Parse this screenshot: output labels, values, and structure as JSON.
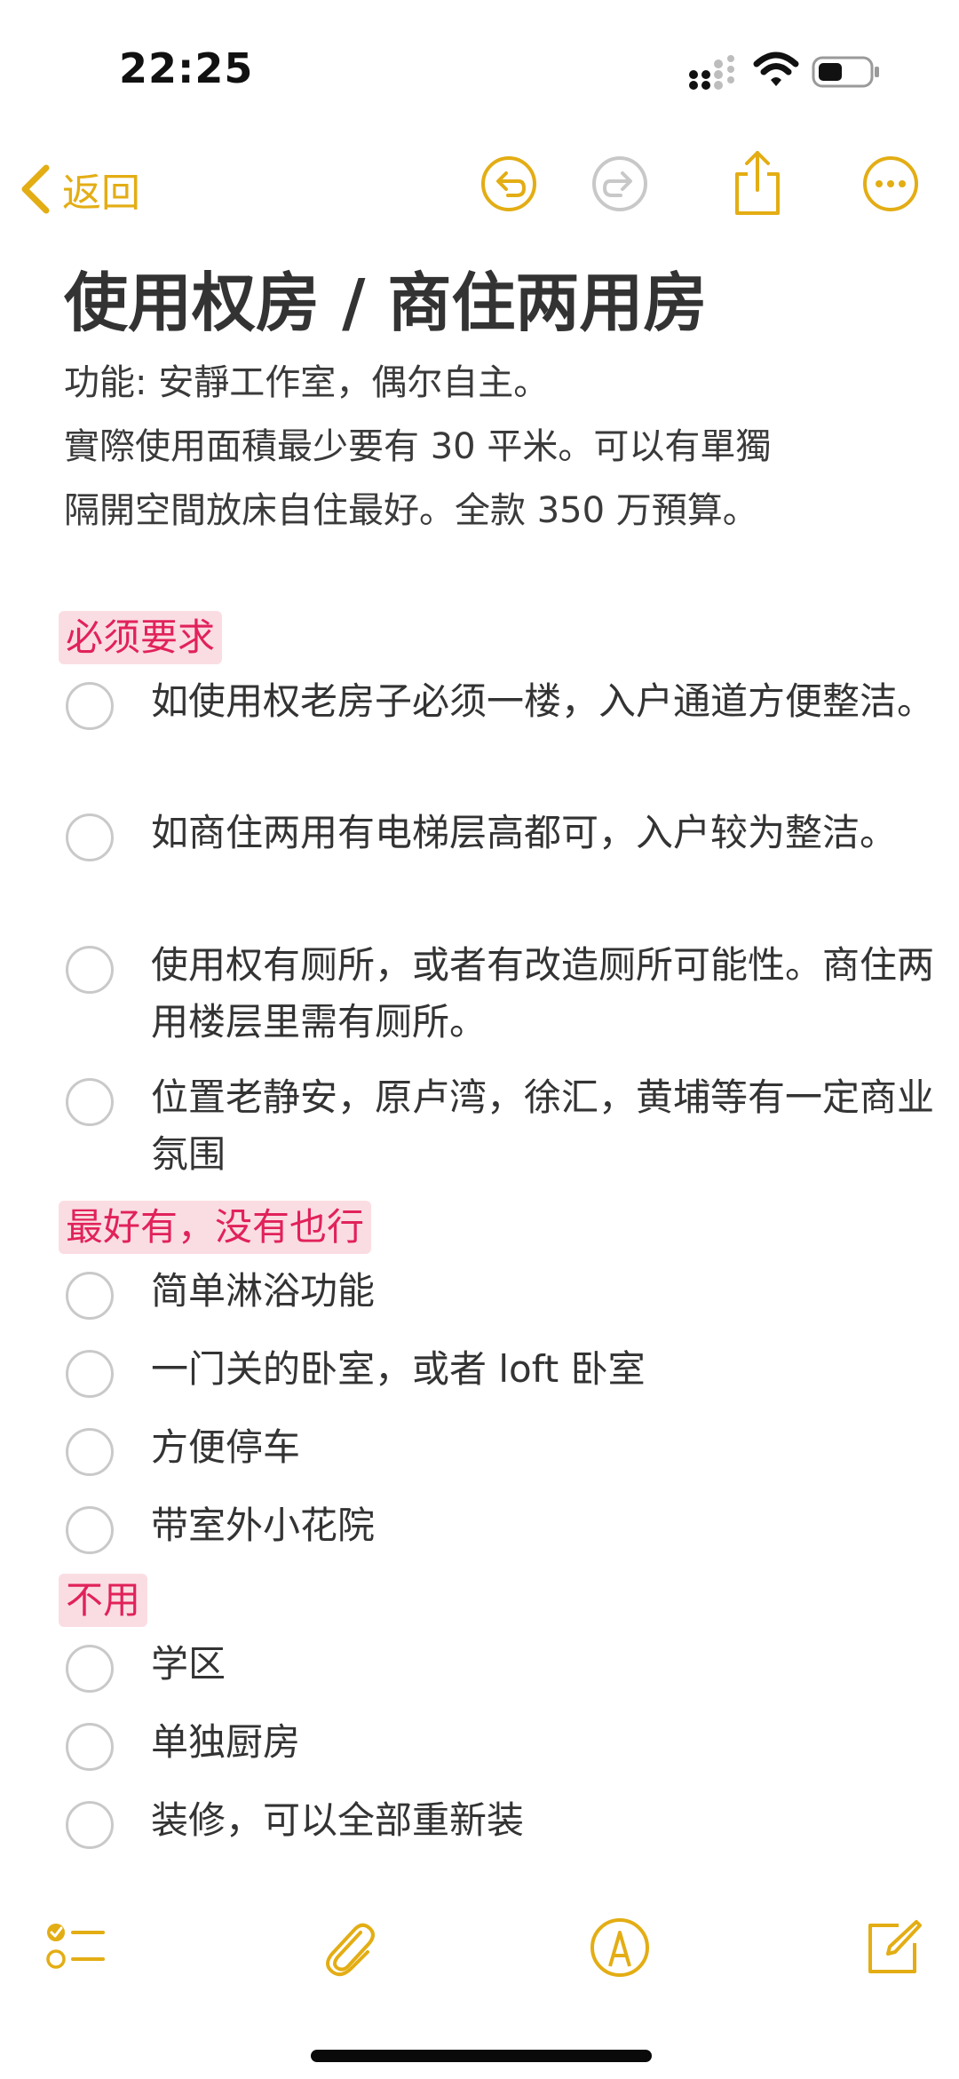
{
  "status_bar": {
    "time": "22:25"
  },
  "nav": {
    "back_label": "返回"
  },
  "note": {
    "title": "使用权房 / 商住两用房",
    "body_lines": [
      "功能: 安靜工作室，偶尔自主。",
      "實際使用面積最少要有 30 平米。可以有單獨",
      "隔開空間放床自住最好。全款 350 万預算。"
    ],
    "sections": [
      {
        "tag": "必须要求",
        "items": [
          "如使用权老房子必须一楼，入户通道方便整洁。",
          "如商住两用有电梯层高都可，入户较为整洁。",
          "使用权有厕所，或者有改造厕所可能性。商住两用楼层里需有厕所。",
          "位置老静安，原卢湾，徐汇，黄埔等有一定商业氛围"
        ]
      },
      {
        "tag": "最好有，没有也行",
        "items": [
          "简单淋浴功能",
          "一门关的卧室，或者 loft 卧室",
          "方便停车",
          "带室外小花院"
        ]
      },
      {
        "tag": "不用",
        "items": [
          "学区",
          "单独厨房",
          "装修，可以全部重新装"
        ]
      }
    ]
  },
  "colors": {
    "accent": "#e3ad14",
    "tag_text": "#e1225a",
    "tag_bg": "#fadde3",
    "checkbox_border": "#c9c9c9"
  },
  "icons": {
    "nav": [
      "chevron-left-icon",
      "undo-icon",
      "redo-icon",
      "share-icon",
      "more-icon"
    ],
    "toolbar": [
      "checklist-icon",
      "paperclip-icon",
      "markup-pen-icon",
      "compose-icon"
    ]
  }
}
